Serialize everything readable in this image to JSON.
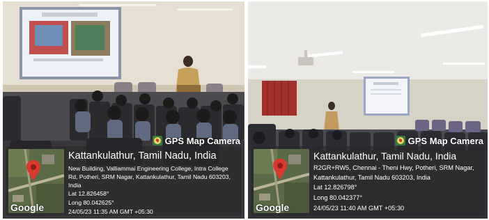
{
  "images": [
    {
      "app_label": "GPS Map Camera",
      "map_watermark": "Google",
      "location_title": "Kattankulathur, Tamil Nadu, India",
      "address": "New Building, Valliammai Engineering College, Intra College Rd, Potheri, SRM Nagar, Kattankulathur, Tamil Nadu 603203, India",
      "latitude": "Lat 12.826458°",
      "longitude": "Long 80.042625°",
      "timestamp": "24/05/23 11:35 AM GMT +05:30"
    },
    {
      "app_label": "GPS Map Camera",
      "map_watermark": "Google",
      "location_title": "Kattankulathur, Tamil Nadu, India",
      "address": "R2GR+RW5, Chennai - Theni Hwy, Potheri, SRM Nagar, Kattankulathur, Tamil Nadu 603203, India",
      "latitude": "Lat 12.826798°",
      "longitude": "Long 80.042377°",
      "timestamp": "24/05/23 11:40 AM GMT +05:30"
    }
  ]
}
